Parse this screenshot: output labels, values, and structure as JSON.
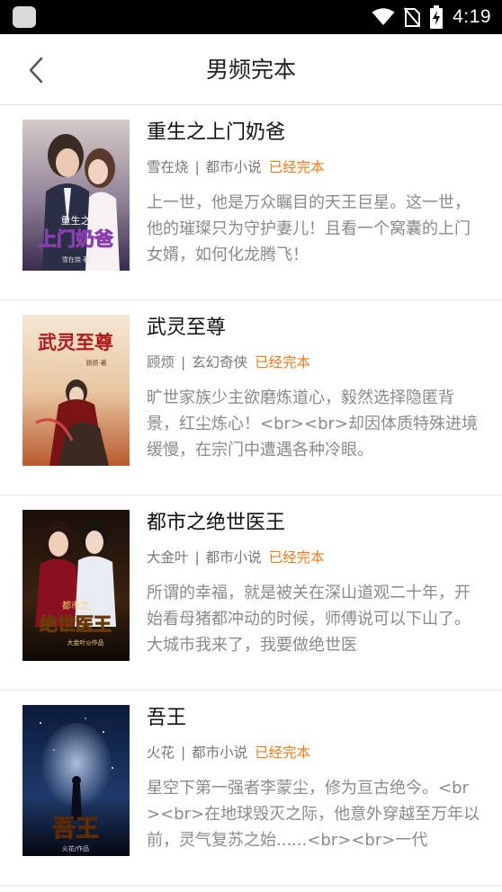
{
  "status_bar": {
    "time": "4:19",
    "icons": [
      "app-icon",
      "wifi-icon",
      "no-sim-icon",
      "battery-charging-icon"
    ]
  },
  "nav": {
    "back_icon": "chevron-left-icon",
    "title": "男频完本"
  },
  "books": [
    {
      "title": "重生之上门奶爸",
      "author": "雪在烧",
      "category": "都市小说",
      "status": "已经完本",
      "description": "上一世，他是万众瞩目的天王巨星。这一世，他的璀璨只为守护妻儿！且看一个窝囊的上门女婿，如何化龙腾飞！",
      "cover_text": [
        "重生之",
        "上门奶爸",
        "雪在烧 著"
      ]
    },
    {
      "title": "武灵至尊",
      "author": "顾烦",
      "category": "玄幻奇侠",
      "status": "已经完本",
      "description": "旷世家族少主欲磨炼道心，毅然选择隐匿背景，红尘炼心！<br><br>却因体质特殊进境缓慢，在宗门中遭遇各种冷眼。",
      "cover_text": [
        "武灵至尊",
        "顾烦·著"
      ]
    },
    {
      "title": "都市之绝世医王",
      "author": "大金叶",
      "category": "都市小说",
      "status": "已经完本",
      "description": "所谓的幸福，就是被关在深山道观二十年，开始看母猪都冲动的时候，师傅说可以下山了。大城市我来了，我要做绝世医",
      "cover_text": [
        "都市之",
        "绝世医王",
        "大金叶◎作品"
      ]
    },
    {
      "title": "吾王",
      "author": "火花",
      "category": "都市小说",
      "status": "已经完本",
      "description": "星空下第一强者李蒙尘，修为亘古绝今。<br><br>在地球毁灭之际，他意外穿越至万年以前，灵气复苏之始......<br><br>一代",
      "cover_text": [
        "吾王",
        "火花/作品"
      ]
    }
  ],
  "colors": {
    "status_accent": "#f07b1e",
    "status_bar_bg": "#000000",
    "divider": "#e6e6e6"
  }
}
